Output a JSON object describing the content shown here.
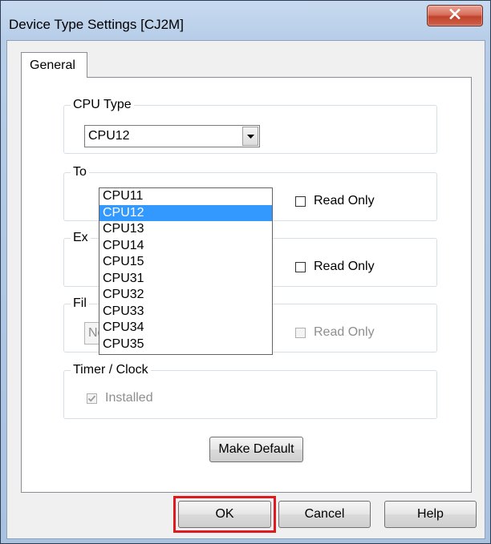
{
  "window": {
    "title": "Device Type Settings [CJ2M]",
    "close_glyph": "x"
  },
  "tabs": [
    {
      "label": "General"
    }
  ],
  "cpu_type": {
    "group_label": "CPU Type",
    "selected": "CPU12",
    "options": [
      "CPU11",
      "CPU12",
      "CPU13",
      "CPU14",
      "CPU15",
      "CPU31",
      "CPU32",
      "CPU33",
      "CPU34",
      "CPU35"
    ],
    "selected_index": 1
  },
  "group2": {
    "label_partial": "To",
    "read_only_label": "Read Only"
  },
  "group3": {
    "label_partial": "Ex",
    "read_only_label": "Read Only"
  },
  "group4": {
    "label_partial": "Fil",
    "combo_value": "None",
    "read_only_label": "Read Only"
  },
  "timer_clock": {
    "group_label": "Timer / Clock",
    "installed_label": "Installed",
    "installed_checked": true
  },
  "buttons": {
    "make_default": "Make Default",
    "ok": "OK",
    "cancel": "Cancel",
    "help": "Help"
  },
  "colors": {
    "selection": "#3399ff",
    "highlight_outline": "#e0181f",
    "close_button": "#c0432c"
  }
}
